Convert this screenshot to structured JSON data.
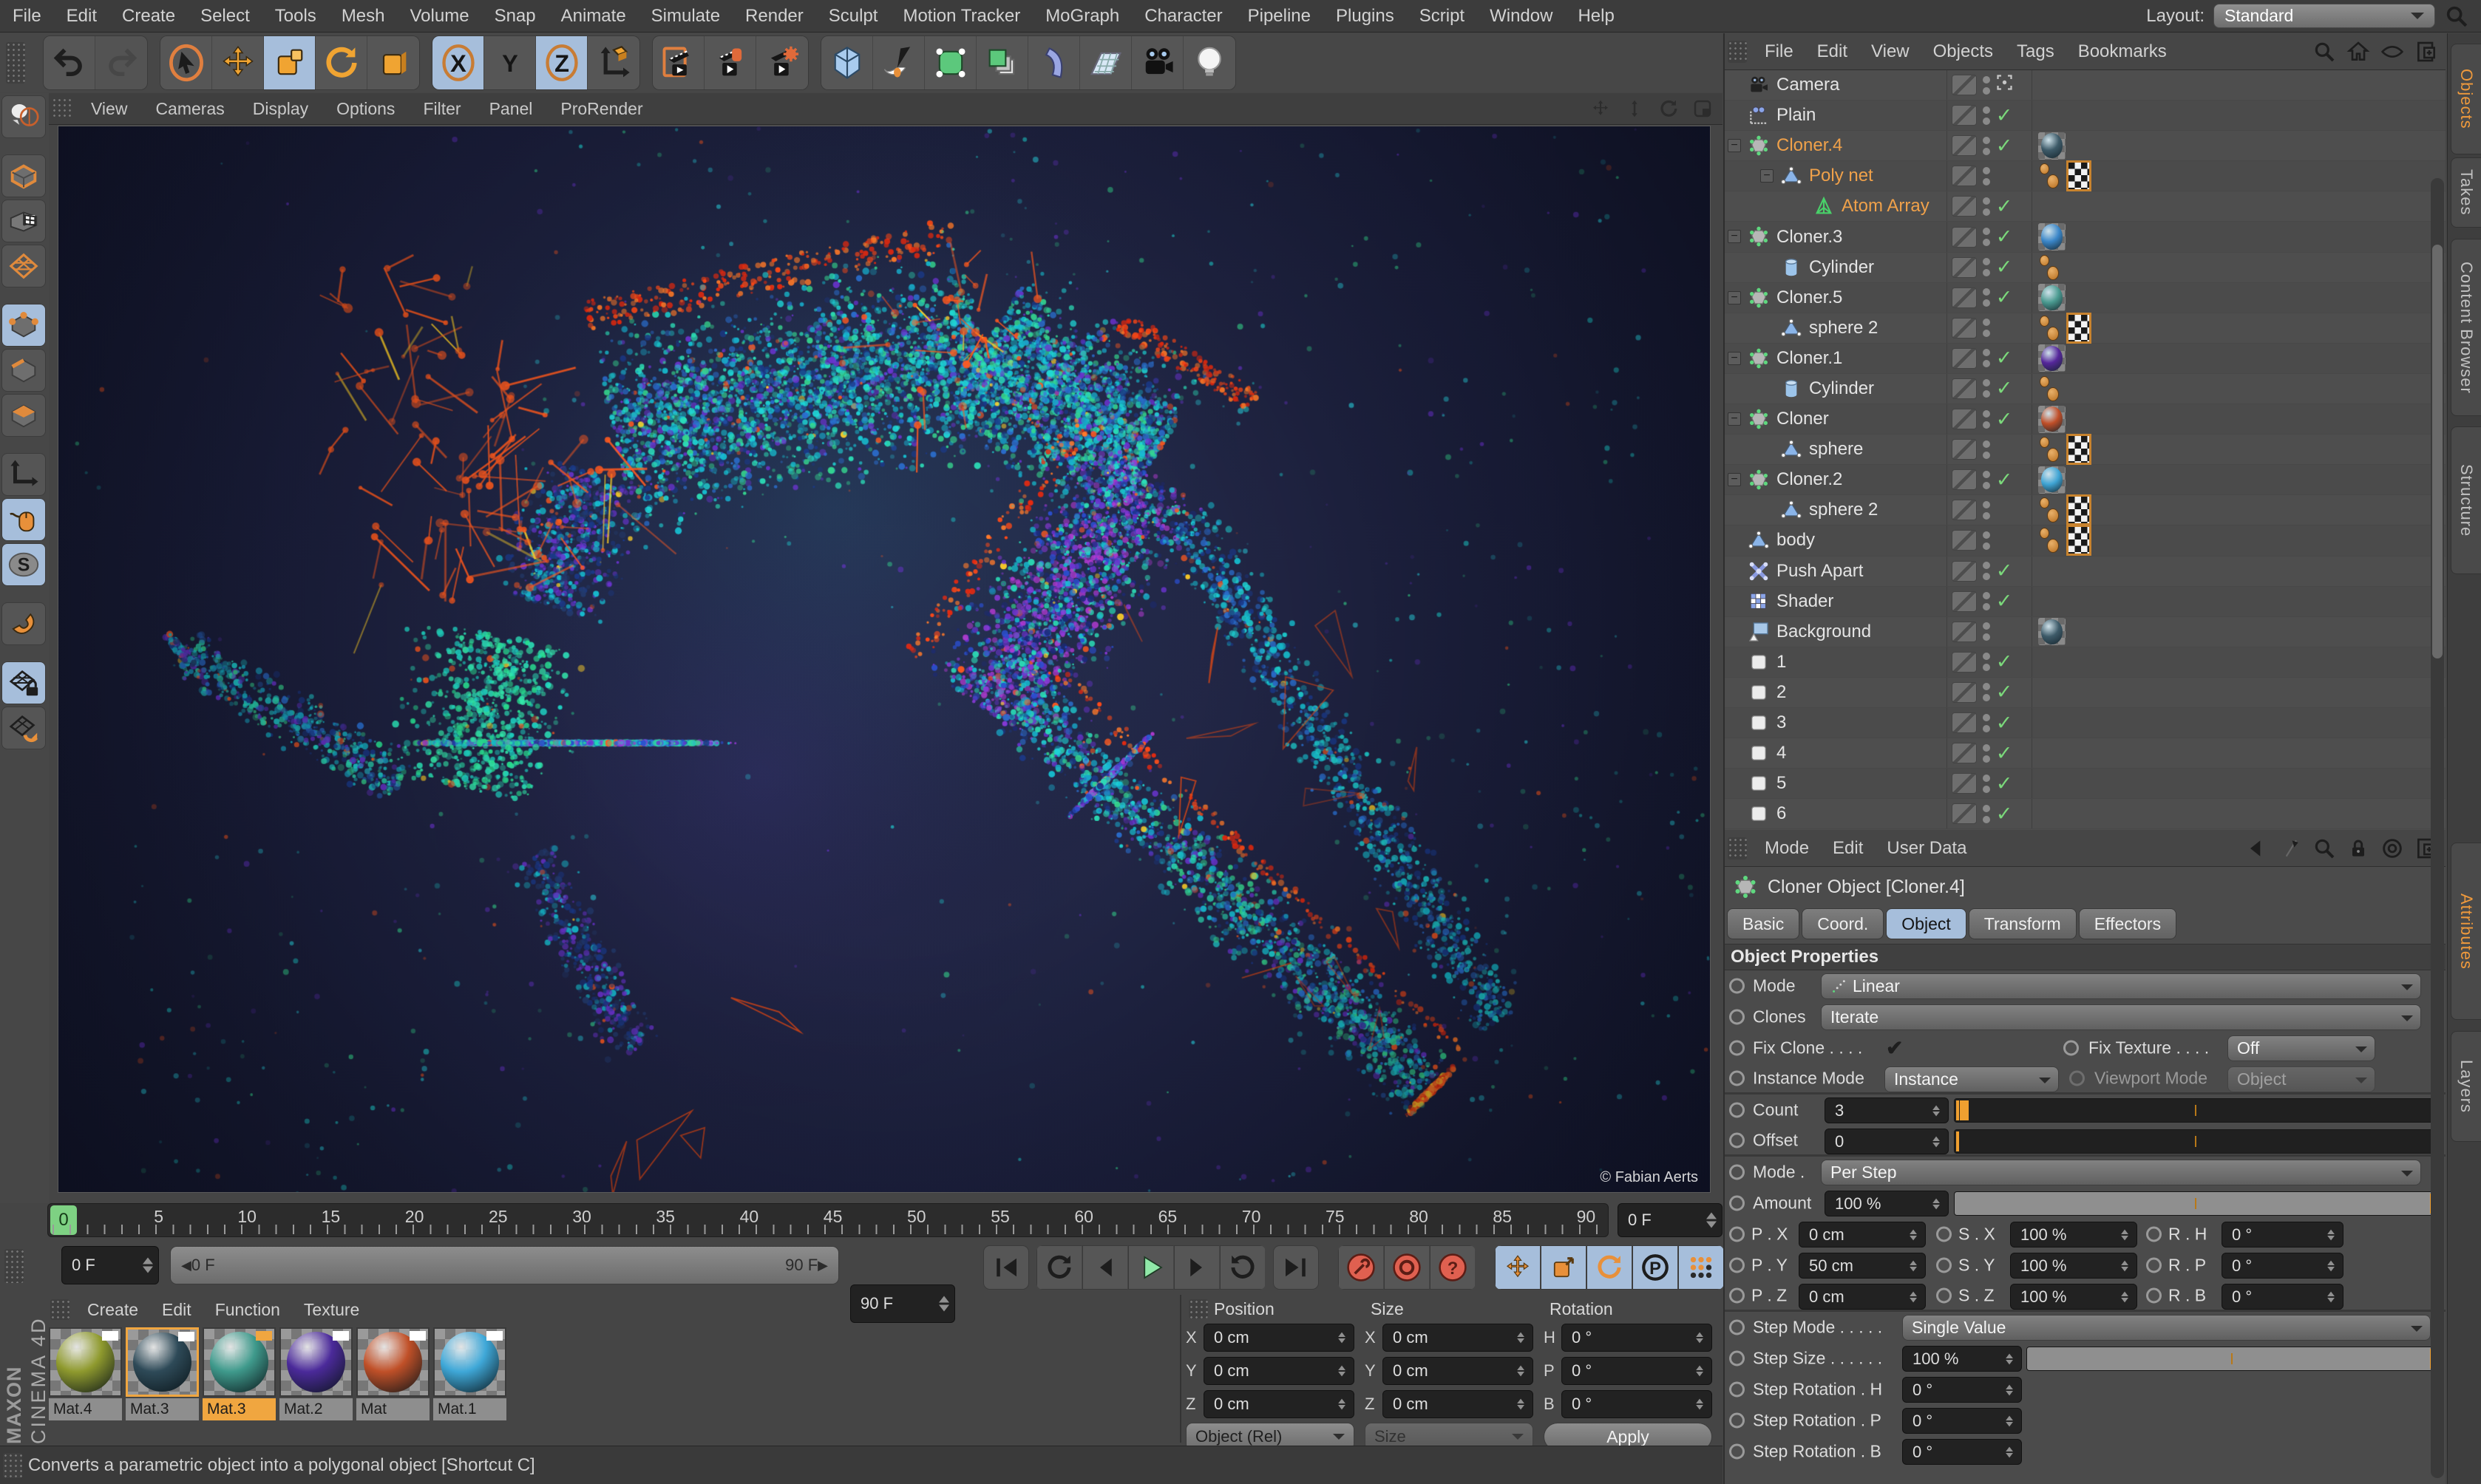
{
  "menu_bar": {
    "items": [
      "File",
      "Edit",
      "Create",
      "Select",
      "Tools",
      "Mesh",
      "Volume",
      "Snap",
      "Animate",
      "Simulate",
      "Render",
      "Sculpt",
      "Motion Tracker",
      "MoGraph",
      "Character",
      "Pipeline",
      "Plugins",
      "Script",
      "Window",
      "Help"
    ],
    "layout_label": "Layout:",
    "layout_value": "Standard"
  },
  "toolbar": {
    "groups": [
      {
        "icons": [
          "undo-icon",
          "redo-icon"
        ],
        "active": [],
        "disabled": [
          1
        ]
      },
      {
        "icons": [
          "live-selection-icon",
          "move-icon",
          "scale-icon",
          "rotate-icon",
          "last-used-tool-icon"
        ],
        "active": [
          2
        ],
        "disabled": []
      },
      {
        "icons": [
          "x-axis-lock-icon",
          "y-axis-lock-icon",
          "z-axis-lock-icon",
          "coordinate-system-icon"
        ],
        "active": [
          0,
          2
        ],
        "disabled": []
      },
      {
        "icons": [
          "render-view-icon",
          "render-picture-viewer-icon",
          "render-settings-icon"
        ],
        "active": [],
        "disabled": []
      },
      {
        "icons": [
          "add-cube-icon",
          "add-spline-icon",
          "add-generator-icon",
          "add-modeling-icon",
          "add-deformer-icon",
          "add-environment-icon",
          "add-camera-icon",
          "add-light-icon"
        ],
        "active": [],
        "disabled": []
      }
    ]
  },
  "left_toolbar": {
    "items": [
      "make-editable-icon",
      "model-mode-icon",
      "texture-mode-icon",
      "workplane-mode-icon",
      "points-mode-icon",
      "edges-mode-icon",
      "polygons-mode-icon",
      "axis-mode-icon",
      "tweak-mode-icon",
      "viewport-solo-icon",
      "snap-icon",
      "workplane-lock-icon",
      "workplane-align-icon"
    ],
    "active": [
      4,
      8,
      9,
      11
    ]
  },
  "viewport": {
    "menus": [
      "View",
      "Cameras",
      "Display",
      "Options",
      "Filter",
      "Panel",
      "ProRender"
    ],
    "corner_icons": [
      "pan-view-icon",
      "zoom-view-icon",
      "rotate-view-icon",
      "maximize-view-icon"
    ],
    "credit": "© Fabian Aerts"
  },
  "object_manager": {
    "menus": [
      "File",
      "Edit",
      "View",
      "Objects",
      "Tags",
      "Bookmarks"
    ],
    "header_icons": [
      "search-icon",
      "home-icon",
      "eye-icon",
      "add-panel-icon"
    ],
    "side_tabs": [
      {
        "label": "Objects",
        "active": true
      },
      {
        "label": "Takes",
        "active": false
      },
      {
        "label": "Content Browser",
        "active": false
      },
      {
        "label": "Structure",
        "active": false
      }
    ],
    "rows": [
      {
        "name": "Camera",
        "icon": "camera-object-icon",
        "depth": 0,
        "state": "target",
        "selected": false,
        "expand": false,
        "tags": []
      },
      {
        "name": "Plain",
        "icon": "plain-effector-icon",
        "depth": 0,
        "state": "check",
        "selected": false,
        "expand": false,
        "tags": []
      },
      {
        "name": "Cloner.4",
        "icon": "cloner-icon",
        "depth": 0,
        "state": "check",
        "selected": true,
        "expand": true,
        "tags": [
          "mat:#3d5a68"
        ]
      },
      {
        "name": "Poly net",
        "icon": "polygon-object-icon",
        "depth": 1,
        "state": "none",
        "selected": true,
        "expand": true,
        "tags": [
          "odots",
          "checker"
        ]
      },
      {
        "name": "Atom Array",
        "icon": "atom-array-icon",
        "depth": 2,
        "state": "check",
        "selected": true,
        "expand": false,
        "tags": []
      },
      {
        "name": "Cloner.3",
        "icon": "cloner-icon",
        "depth": 0,
        "state": "check",
        "selected": false,
        "expand": true,
        "tags": [
          "mat:#3a86c8"
        ]
      },
      {
        "name": "Cylinder",
        "icon": "cylinder-icon",
        "depth": 1,
        "state": "check",
        "selected": false,
        "expand": false,
        "tags": [
          "odots"
        ]
      },
      {
        "name": "Cloner.5",
        "icon": "cloner-icon",
        "depth": 0,
        "state": "check",
        "selected": false,
        "expand": true,
        "tags": [
          "mat:#4a9a90"
        ]
      },
      {
        "name": "sphere 2",
        "icon": "polygon-object-icon",
        "depth": 1,
        "state": "none",
        "selected": false,
        "expand": false,
        "tags": [
          "odots",
          "checker"
        ]
      },
      {
        "name": "Cloner.1",
        "icon": "cloner-icon",
        "depth": 0,
        "state": "check",
        "selected": false,
        "expand": true,
        "tags": [
          "mat:#55269a"
        ]
      },
      {
        "name": "Cylinder",
        "icon": "cylinder-icon",
        "depth": 1,
        "state": "check",
        "selected": false,
        "expand": false,
        "tags": [
          "odots"
        ]
      },
      {
        "name": "Cloner",
        "icon": "cloner-icon",
        "depth": 0,
        "state": "check",
        "selected": false,
        "expand": true,
        "tags": [
          "mat:#c04e28"
        ]
      },
      {
        "name": "sphere",
        "icon": "polygon-object-icon",
        "depth": 1,
        "state": "none",
        "selected": false,
        "expand": false,
        "tags": [
          "odots",
          "checker"
        ]
      },
      {
        "name": "Cloner.2",
        "icon": "cloner-icon",
        "depth": 0,
        "state": "check",
        "selected": false,
        "expand": true,
        "tags": [
          "mat:#3fa4d4"
        ]
      },
      {
        "name": "sphere 2",
        "icon": "polygon-object-icon",
        "depth": 1,
        "state": "none",
        "selected": false,
        "expand": false,
        "tags": [
          "odots",
          "checker"
        ]
      },
      {
        "name": "body",
        "icon": "polygon-object-icon",
        "depth": 0,
        "state": "none",
        "selected": false,
        "expand": false,
        "tags": [
          "odots",
          "checker"
        ]
      },
      {
        "name": "Push Apart",
        "icon": "push-apart-icon",
        "depth": 0,
        "state": "check",
        "selected": false,
        "expand": false,
        "tags": []
      },
      {
        "name": "Shader",
        "icon": "shader-effector-icon",
        "depth": 0,
        "state": "check",
        "selected": false,
        "expand": false,
        "tags": []
      },
      {
        "name": "Background",
        "icon": "background-icon",
        "depth": 0,
        "state": "none",
        "selected": false,
        "expand": false,
        "tags": [
          "mat:#3d5a68"
        ]
      },
      {
        "name": "1",
        "icon": "null-icon",
        "depth": 0,
        "state": "check",
        "selected": false,
        "expand": false,
        "tags": []
      },
      {
        "name": "2",
        "icon": "null-icon",
        "depth": 0,
        "state": "check",
        "selected": false,
        "expand": false,
        "tags": []
      },
      {
        "name": "3",
        "icon": "null-icon",
        "depth": 0,
        "state": "check",
        "selected": false,
        "expand": false,
        "tags": []
      },
      {
        "name": "4",
        "icon": "null-icon",
        "depth": 0,
        "state": "check",
        "selected": false,
        "expand": false,
        "tags": []
      },
      {
        "name": "5",
        "icon": "null-icon",
        "depth": 0,
        "state": "check",
        "selected": false,
        "expand": false,
        "tags": []
      },
      {
        "name": "6",
        "icon": "null-icon",
        "depth": 0,
        "state": "check",
        "selected": false,
        "expand": false,
        "tags": []
      }
    ]
  },
  "attribute_manager": {
    "menus": [
      "Mode",
      "Edit",
      "User Data"
    ],
    "header_icons": [
      "back-icon",
      "forward-icon",
      "search-icon",
      "lock-icon",
      "target-icon",
      "add-panel-icon"
    ],
    "title": "Cloner Object [Cloner.4]",
    "tabs": [
      {
        "label": "Basic",
        "active": false
      },
      {
        "label": "Coord.",
        "active": false
      },
      {
        "label": "Object",
        "active": true
      },
      {
        "label": "Transform",
        "active": false
      },
      {
        "label": "Effectors",
        "active": false
      }
    ],
    "section": "Object Properties",
    "side_tabs": [
      {
        "label": "Attributes",
        "active": true
      },
      {
        "label": "Layers",
        "active": false
      }
    ],
    "rows": [
      {
        "type": "drop",
        "label": "Mode",
        "value": "Linear",
        "icon": "linear-mode-icon"
      },
      {
        "type": "drop",
        "label": "Clones",
        "value": "Iterate"
      },
      {
        "type": "dual_check",
        "left_label": "Fix Clone . . . .",
        "checked": true,
        "right_label": "Fix Texture . . . .",
        "right_value": "Off"
      },
      {
        "type": "dual_drop",
        "left_label": "Instance Mode",
        "left_value": "Instance",
        "right_label": "Viewport Mode",
        "right_value": "Object",
        "right_disabled": true,
        "sep_after": true
      },
      {
        "type": "slider",
        "label": "Count",
        "value": "3",
        "fill": 0.02,
        "theme": "dark"
      },
      {
        "type": "slider",
        "label": "Offset",
        "value": "0",
        "fill": 0,
        "theme": "dark",
        "sep_after": true
      },
      {
        "type": "drop",
        "label": "Mode .",
        "value": "Per Step"
      },
      {
        "type": "slider",
        "label": "Amount",
        "value": "100 %",
        "fill": 1,
        "theme": "light"
      },
      {
        "type": "triple",
        "cells": [
          [
            "P . X",
            "0 cm"
          ],
          [
            "S . X",
            "100 %"
          ],
          [
            "R . H",
            "0 °"
          ]
        ]
      },
      {
        "type": "triple",
        "cells": [
          [
            "P . Y",
            "50 cm"
          ],
          [
            "S . Y",
            "100 %"
          ],
          [
            "R . P",
            "0 °"
          ]
        ]
      },
      {
        "type": "triple",
        "cells": [
          [
            "P . Z",
            "0 cm"
          ],
          [
            "S . Z",
            "100 %"
          ],
          [
            "R . B",
            "0 °"
          ]
        ],
        "sep_after": true
      },
      {
        "type": "dropwide",
        "label": "Step Mode . . . . .",
        "value": "Single Value"
      },
      {
        "type": "slider2",
        "label": "Step Size . . . . . .",
        "value": "100 %",
        "fill": 1
      },
      {
        "type": "field",
        "label": "Step Rotation . H",
        "value": "0 °"
      },
      {
        "type": "field",
        "label": "Step Rotation . P",
        "value": "0 °"
      },
      {
        "type": "field",
        "label": "Step Rotation . B",
        "value": "0 °"
      }
    ]
  },
  "timeline": {
    "labels": [
      "0",
      "5",
      "10",
      "15",
      "20",
      "25",
      "30",
      "35",
      "40",
      "45",
      "50",
      "55",
      "60",
      "65",
      "70",
      "75",
      "80",
      "85",
      "90"
    ],
    "playhead": "0",
    "current_frame": "0 F"
  },
  "transport": {
    "start_field": "0 F",
    "range_start": "0 F",
    "range_end": "90 F",
    "end_field": "90 F",
    "buttons": [
      "goto-start-icon",
      "prev-key-icon",
      "prev-frame-icon",
      "play-icon",
      "next-frame-icon",
      "next-key-icon",
      "goto-end-icon"
    ],
    "record_buttons": [
      "record-keyframe-icon",
      "autokey-icon",
      "help-icon"
    ],
    "toggle_buttons": [
      "key-position-icon",
      "key-scale-icon",
      "key-rotation-icon",
      "key-parameter-icon",
      "key-pla-icon"
    ],
    "extra_buttons": [
      "keyframe-selection-icon"
    ]
  },
  "material_manager": {
    "menus": [
      "Create",
      "Edit",
      "Function",
      "Texture"
    ],
    "materials": [
      {
        "name": "Mat.4",
        "color": "#8f9a2e",
        "chip": "#ffffff",
        "thumb_selected": false,
        "label_selected": false
      },
      {
        "name": "Mat.3",
        "color": "#2e4a58",
        "chip": "#ffffff",
        "thumb_selected": true,
        "label_selected": false
      },
      {
        "name": "Mat.3",
        "color": "#3f9a8c",
        "chip": "#f0a640",
        "thumb_selected": false,
        "label_selected": true
      },
      {
        "name": "Mat.2",
        "color": "#4b2a9a",
        "chip": "#ffffff",
        "thumb_selected": false,
        "label_selected": false
      },
      {
        "name": "Mat",
        "color": "#c05028",
        "chip": "#ffffff",
        "thumb_selected": false,
        "label_selected": false
      },
      {
        "name": "Mat.1",
        "color": "#3fa8d8",
        "chip": "#ffffff",
        "thumb_selected": false,
        "label_selected": false
      }
    ]
  },
  "coordinates": {
    "headers": [
      "Position",
      "Size",
      "Rotation"
    ],
    "position_rows": [
      [
        "X",
        "0 cm"
      ],
      [
        "Y",
        "0 cm"
      ],
      [
        "Z",
        "0 cm"
      ]
    ],
    "size_rows": [
      [
        "X",
        "0 cm"
      ],
      [
        "Y",
        "0 cm"
      ],
      [
        "Z",
        "0 cm"
      ]
    ],
    "rotation_rows": [
      [
        "H",
        "0 °"
      ],
      [
        "P",
        "0 °"
      ],
      [
        "B",
        "0 °"
      ]
    ],
    "position_dropdown": "Object (Rel)",
    "size_dropdown": "Size",
    "apply_label": "Apply"
  },
  "status_bar": {
    "text": "Converts a parametric object into a polygonal object [Shortcut C]"
  },
  "branding": {
    "line1": "MAXON",
    "line2": "CINEMA 4D"
  }
}
